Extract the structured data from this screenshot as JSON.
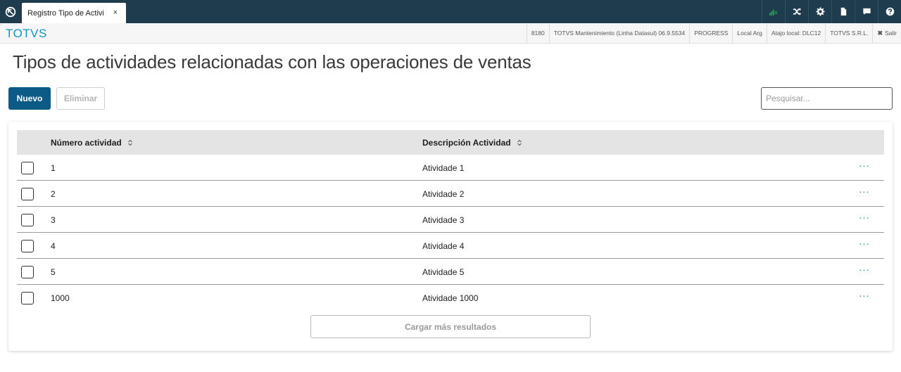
{
  "tab": {
    "title": "Registro Tipo de Activi",
    "close": "×"
  },
  "top_icons": [
    "signal-icon",
    "shuffle-icon",
    "gear-icon",
    "document-icon",
    "chat-icon",
    "help-icon"
  ],
  "brand": "TOTVS",
  "info": {
    "code": "8180",
    "product": "TOTVS Mantenimiento (Linha Datasul) 06.9.5534",
    "db": "PROGRESS",
    "locale": "Local Arg",
    "shortcut": "Atajo local: DLC12",
    "company": "TOTVS S.R.L.",
    "logout_icon": "✖",
    "logout": "Salir"
  },
  "page_title": "Tipos de actividades relacionadas con las operaciones de ventas",
  "actions": {
    "new_label": "Nuevo",
    "delete_label": "Eliminar"
  },
  "search": {
    "placeholder": "Pesquisar..."
  },
  "table": {
    "columns": [
      "Número actividad",
      "Descripción Actividad"
    ],
    "rows": [
      {
        "num": "1",
        "desc": "Atividade 1"
      },
      {
        "num": "2",
        "desc": "Atividade 2"
      },
      {
        "num": "3",
        "desc": "Atividade 3"
      },
      {
        "num": "4",
        "desc": "Atividade 4"
      },
      {
        "num": "5",
        "desc": "Atividade 5"
      },
      {
        "num": "1000",
        "desc": "Atividade 1000"
      }
    ],
    "row_action": "···",
    "load_more": "Cargar más resultados"
  },
  "colors": {
    "topbar": "#1f3c4e",
    "brand": "#1594c1",
    "primary": "#0c5b87",
    "signal": "#22b14c"
  }
}
